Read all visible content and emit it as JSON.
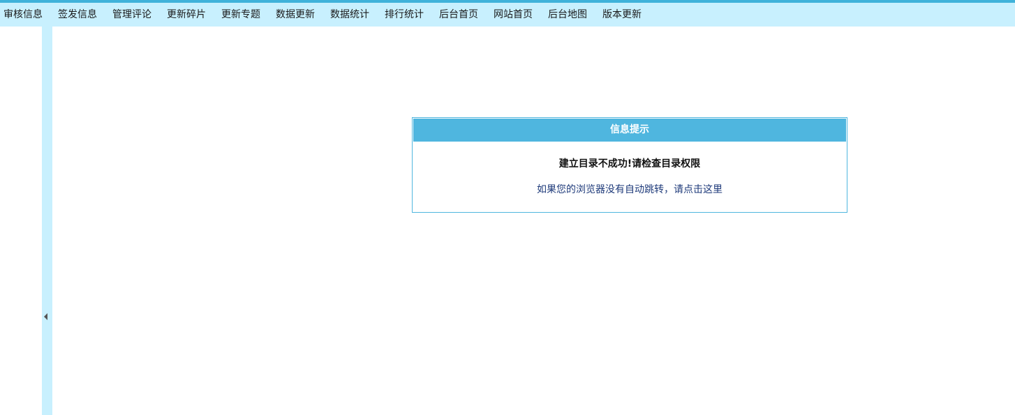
{
  "nav": {
    "items": [
      {
        "label": "审核信息"
      },
      {
        "label": "签发信息"
      },
      {
        "label": "管理评论"
      },
      {
        "label": "更新碎片"
      },
      {
        "label": "更新专题"
      },
      {
        "label": "数据更新"
      },
      {
        "label": "数据统计"
      },
      {
        "label": "排行统计"
      },
      {
        "label": "后台首页"
      },
      {
        "label": "网站首页"
      },
      {
        "label": "后台地图"
      },
      {
        "label": "版本更新"
      }
    ]
  },
  "splitter": {
    "icon": "caret-left-icon"
  },
  "message": {
    "title": "信息提示",
    "text": "建立目录不成功!请检查目录权限",
    "redirect_link": "如果您的浏览器没有自动跳转，请点击这里"
  },
  "colors": {
    "accent": "#3fb2da",
    "nav_bg": "#c8f0fe",
    "header_bg": "#4fb6df",
    "link": "#1e3a7a"
  }
}
